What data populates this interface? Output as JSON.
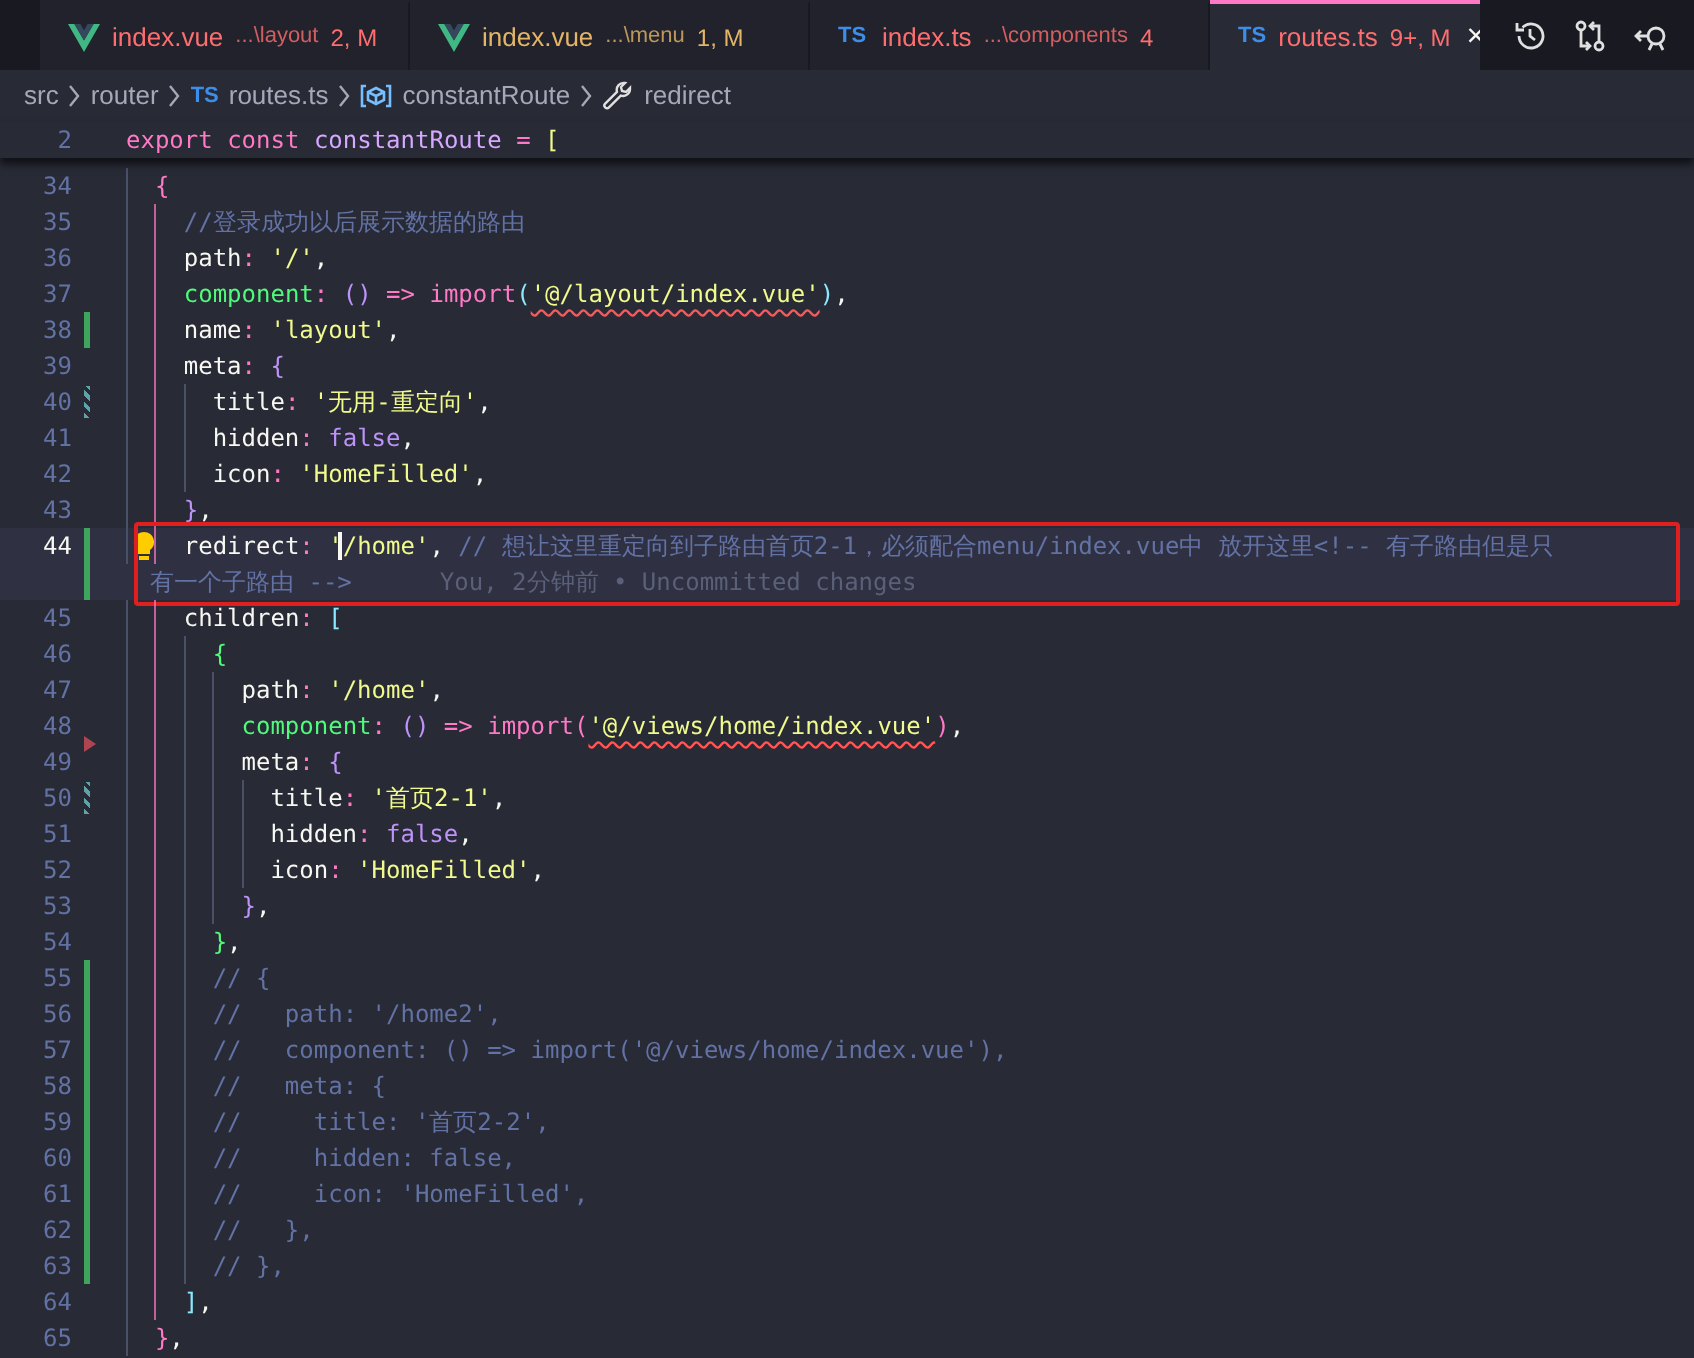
{
  "tabs": [
    {
      "kind": "vue",
      "name": "index.vue",
      "path": "...\\layout",
      "badge": "2, M",
      "error": true,
      "warning": false,
      "selected": false
    },
    {
      "kind": "vue",
      "name": "index.vue",
      "path": "...\\menu",
      "badge": "1, M",
      "error": false,
      "warning": true,
      "selected": false
    },
    {
      "kind": "ts",
      "icon_label": "TS",
      "name": "index.ts",
      "path": "...\\components",
      "badge": "4",
      "error": true,
      "warning": false,
      "selected": false
    },
    {
      "kind": "ts",
      "icon_label": "TS",
      "name": "routes.ts",
      "badge": "9+, M",
      "error": true,
      "warning": false,
      "selected": true,
      "close": "×"
    }
  ],
  "breadcrumb": [
    {
      "kind": "folder",
      "label": "src"
    },
    {
      "kind": "folder",
      "label": "router"
    },
    {
      "kind": "file",
      "icon_label": "TS",
      "label": "routes.ts"
    },
    {
      "kind": "symbol",
      "label": "constantRoute"
    },
    {
      "kind": "property",
      "label": "redirect"
    }
  ],
  "sticky_line": {
    "number": "2",
    "tokens": [
      {
        "kind": "keyword",
        "text": "export "
      },
      {
        "kind": "keyword",
        "text": "const "
      },
      {
        "kind": "variable",
        "text": "constantRoute"
      },
      {
        "kind": "punct",
        "text": " = "
      },
      {
        "kind": "bracket",
        "color": "#f1fa8c",
        "text": "["
      }
    ]
  },
  "lines": [
    {
      "number": "34",
      "added": false,
      "modified": false,
      "deleted": false,
      "tokens": [
        {
          "kind": "bracket",
          "color": "#ff79c6",
          "text": "  {"
        }
      ]
    },
    {
      "number": "35",
      "added": false,
      "modified": false,
      "deleted": false,
      "tokens": [
        {
          "kind": "comment",
          "text": "    //登录成功以后展示数据的路由"
        }
      ]
    },
    {
      "number": "36",
      "added": false,
      "modified": false,
      "deleted": false,
      "tokens": [
        {
          "kind": "plain",
          "text": "    path"
        },
        {
          "kind": "punct",
          "text": ": "
        },
        {
          "kind": "string",
          "text": "'/'"
        },
        {
          "kind": "plain",
          "text": ","
        }
      ]
    },
    {
      "number": "37",
      "added": false,
      "modified": false,
      "deleted": false,
      "tokens": [
        {
          "kind": "func",
          "text": "    component"
        },
        {
          "kind": "punct",
          "text": ": "
        },
        {
          "kind": "bracket",
          "color": "#bd93f9",
          "text": "("
        },
        {
          "kind": "bracket",
          "color": "#bd93f9",
          "text": ")"
        },
        {
          "kind": "keyword",
          "text": " => "
        },
        {
          "kind": "keyword",
          "text": "import"
        },
        {
          "kind": "bracket",
          "color": "#8be9fd",
          "text": "("
        },
        {
          "kind": "string",
          "text": "'@/layout/index.vue'",
          "error": true
        },
        {
          "kind": "bracket",
          "color": "#8be9fd",
          "text": ")"
        },
        {
          "kind": "plain",
          "text": ","
        }
      ]
    },
    {
      "number": "38",
      "added": true,
      "modified": false,
      "deleted": false,
      "tokens": [
        {
          "kind": "plain",
          "text": "    name"
        },
        {
          "kind": "punct",
          "text": ": "
        },
        {
          "kind": "string",
          "text": "'layout'"
        },
        {
          "kind": "plain",
          "text": ","
        }
      ]
    },
    {
      "number": "39",
      "added": false,
      "modified": false,
      "deleted": false,
      "tokens": [
        {
          "kind": "plain",
          "text": "    meta"
        },
        {
          "kind": "punct",
          "text": ": "
        },
        {
          "kind": "bracket",
          "color": "#bd93f9",
          "text": "{"
        }
      ]
    },
    {
      "number": "40",
      "added": false,
      "modified": true,
      "deleted": false,
      "tokens": [
        {
          "kind": "plain",
          "text": "      title"
        },
        {
          "kind": "punct",
          "text": ": "
        },
        {
          "kind": "string",
          "text": "'无用-重定向'"
        },
        {
          "kind": "plain",
          "text": ","
        }
      ]
    },
    {
      "number": "41",
      "added": false,
      "modified": false,
      "deleted": false,
      "tokens": [
        {
          "kind": "plain",
          "text": "      hidden"
        },
        {
          "kind": "punct",
          "text": ": "
        },
        {
          "kind": "boolean",
          "text": "false"
        },
        {
          "kind": "plain",
          "text": ","
        }
      ]
    },
    {
      "number": "42",
      "added": false,
      "modified": false,
      "deleted": false,
      "tokens": [
        {
          "kind": "plain",
          "text": "      icon"
        },
        {
          "kind": "punct",
          "text": ": "
        },
        {
          "kind": "string",
          "text": "'HomeFilled'"
        },
        {
          "kind": "plain",
          "text": ","
        }
      ]
    },
    {
      "number": "43",
      "added": false,
      "modified": false,
      "deleted": false,
      "tokens": [
        {
          "kind": "bracket",
          "color": "#bd93f9",
          "text": "    }"
        },
        {
          "kind": "plain",
          "text": ","
        }
      ]
    },
    {
      "number": "44",
      "added": true,
      "modified": false,
      "deleted": false,
      "active": true,
      "highlighted": true,
      "lightbulb": true,
      "tokens": [
        {
          "kind": "plain",
          "text": "    redirect"
        },
        {
          "kind": "punct",
          "text": ": "
        },
        {
          "kind": "string",
          "text": "'"
        },
        {
          "kind": "string",
          "cursor": true,
          "text": "/home'"
        },
        {
          "kind": "plain",
          "text": ", "
        },
        {
          "kind": "comment",
          "text": "// 想让这里重定向到子路由首页2-1，必须配合menu/index.vue中 放开这里<!-- 有子路由但是只"
        }
      ],
      "continuation": [
        {
          "kind": "comment",
          "text": "有一个子路由 -->"
        }
      ],
      "blame": "You, 2分钟前 • Uncommitted changes"
    },
    {
      "number": "45",
      "added": false,
      "modified": false,
      "deleted": false,
      "tokens": [
        {
          "kind": "plain",
          "text": "    children"
        },
        {
          "kind": "punct",
          "text": ": "
        },
        {
          "kind": "bracket",
          "color": "#8be9fd",
          "text": "["
        }
      ]
    },
    {
      "number": "46",
      "added": false,
      "modified": false,
      "deleted": false,
      "tokens": [
        {
          "kind": "bracket",
          "color": "#50fa7b",
          "text": "      {"
        }
      ]
    },
    {
      "number": "47",
      "added": false,
      "modified": false,
      "deleted": false,
      "tokens": [
        {
          "kind": "plain",
          "text": "        path"
        },
        {
          "kind": "punct",
          "text": ": "
        },
        {
          "kind": "string",
          "text": "'/home'"
        },
        {
          "kind": "plain",
          "text": ","
        }
      ]
    },
    {
      "number": "48",
      "added": false,
      "modified": false,
      "deleted": false,
      "tokens": [
        {
          "kind": "func",
          "text": "        component"
        },
        {
          "kind": "punct",
          "text": ": "
        },
        {
          "kind": "bracket",
          "color": "#bd93f9",
          "text": "("
        },
        {
          "kind": "bracket",
          "color": "#bd93f9",
          "text": ")"
        },
        {
          "kind": "keyword",
          "text": " => "
        },
        {
          "kind": "keyword",
          "text": "import"
        },
        {
          "kind": "bracket",
          "color": "#ff79c6",
          "text": "("
        },
        {
          "kind": "string",
          "text": "'@/views/home/index.vue'",
          "error": true
        },
        {
          "kind": "bracket",
          "color": "#ff79c6",
          "text": ")"
        },
        {
          "kind": "plain",
          "text": ","
        }
      ]
    },
    {
      "number": "49",
      "added": false,
      "modified": false,
      "deleted": true,
      "tokens": [
        {
          "kind": "plain",
          "text": "        meta"
        },
        {
          "kind": "punct",
          "text": ": "
        },
        {
          "kind": "bracket",
          "color": "#bd93f9",
          "text": "{"
        }
      ]
    },
    {
      "number": "50",
      "added": false,
      "modified": true,
      "deleted": false,
      "tokens": [
        {
          "kind": "plain",
          "text": "          title"
        },
        {
          "kind": "punct",
          "text": ": "
        },
        {
          "kind": "string",
          "text": "'首页2-1'"
        },
        {
          "kind": "plain",
          "text": ","
        }
      ]
    },
    {
      "number": "51",
      "added": false,
      "modified": false,
      "deleted": false,
      "tokens": [
        {
          "kind": "plain",
          "text": "          hidden"
        },
        {
          "kind": "punct",
          "text": ": "
        },
        {
          "kind": "boolean",
          "text": "false"
        },
        {
          "kind": "plain",
          "text": ","
        }
      ]
    },
    {
      "number": "52",
      "added": false,
      "modified": false,
      "deleted": false,
      "tokens": [
        {
          "kind": "plain",
          "text": "          icon"
        },
        {
          "kind": "punct",
          "text": ": "
        },
        {
          "kind": "string",
          "text": "'HomeFilled'"
        },
        {
          "kind": "plain",
          "text": ","
        }
      ]
    },
    {
      "number": "53",
      "added": false,
      "modified": false,
      "deleted": false,
      "tokens": [
        {
          "kind": "bracket",
          "color": "#bd93f9",
          "text": "        }"
        },
        {
          "kind": "plain",
          "text": ","
        }
      ]
    },
    {
      "number": "54",
      "added": false,
      "modified": false,
      "deleted": false,
      "tokens": [
        {
          "kind": "bracket",
          "color": "#50fa7b",
          "text": "      }"
        },
        {
          "kind": "plain",
          "text": ","
        }
      ]
    },
    {
      "number": "55",
      "added": true,
      "modified": false,
      "deleted": false,
      "tokens": [
        {
          "kind": "comment",
          "text": "      // {"
        }
      ]
    },
    {
      "number": "56",
      "added": true,
      "modified": false,
      "deleted": false,
      "tokens": [
        {
          "kind": "comment",
          "text": "      //   path: '/home2',"
        }
      ]
    },
    {
      "number": "57",
      "added": true,
      "modified": false,
      "deleted": false,
      "tokens": [
        {
          "kind": "comment",
          "text": "      //   component: () => import('@/views/home/index.vue'),"
        }
      ]
    },
    {
      "number": "58",
      "added": true,
      "modified": false,
      "deleted": false,
      "tokens": [
        {
          "kind": "comment",
          "text": "      //   meta: {"
        }
      ]
    },
    {
      "number": "59",
      "added": true,
      "modified": false,
      "deleted": false,
      "tokens": [
        {
          "kind": "comment",
          "text": "      //     title: '首页2-2',"
        }
      ]
    },
    {
      "number": "60",
      "added": true,
      "modified": false,
      "deleted": false,
      "tokens": [
        {
          "kind": "comment",
          "text": "      //     hidden: false,"
        }
      ]
    },
    {
      "number": "61",
      "added": true,
      "modified": false,
      "deleted": false,
      "tokens": [
        {
          "kind": "comment",
          "text": "      //     icon: 'HomeFilled',"
        }
      ]
    },
    {
      "number": "62",
      "added": true,
      "modified": false,
      "deleted": false,
      "tokens": [
        {
          "kind": "comment",
          "text": "      //   },"
        }
      ]
    },
    {
      "number": "63",
      "added": true,
      "modified": false,
      "deleted": false,
      "tokens": [
        {
          "kind": "comment",
          "text": "      // },"
        }
      ]
    },
    {
      "number": "64",
      "added": false,
      "modified": false,
      "deleted": false,
      "tokens": [
        {
          "kind": "bracket",
          "color": "#8be9fd",
          "text": "    ]"
        },
        {
          "kind": "plain",
          "text": ","
        }
      ]
    },
    {
      "number": "65",
      "added": false,
      "modified": false,
      "deleted": false,
      "tokens": [
        {
          "kind": "bracket",
          "color": "#ff79c6",
          "text": "  }"
        },
        {
          "kind": "plain",
          "text": ","
        }
      ]
    }
  ]
}
